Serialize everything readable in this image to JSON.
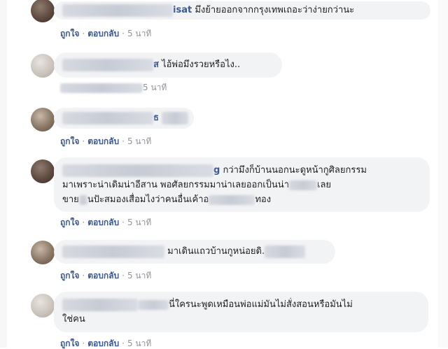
{
  "actions": {
    "like": "ถูกใจ",
    "reply": "ตอบกลับ",
    "dot": "·",
    "time": "5 นาที"
  },
  "comments": [
    {
      "name_visible": "isat",
      "text": "มึงย้ายออกจากกรุงเทพเถอะว่าง่ายกว่านะ"
    },
    {
      "name_visible": "ส",
      "text": "ไอ้พ่อมึงรวยหรือไง.."
    },
    {
      "name_visible": "ธ",
      "text": ""
    },
    {
      "name_visible": "g",
      "text_line1": "กว่ามึงก็บ้านนอกนะดูหน้ากูศิลยกรรม",
      "text_line2": "มาเพราะน่าเดิมน่าอีสาน พอศัลยกรรมมาน่าเลยออกเป็นน่า",
      "text_line2_end": "เลย",
      "text_line3": "ขาย",
      "text_line3_mid": "นปัะสมองเสื่อมไงว่าคนอื่นเค้าอ",
      "text_line3_end": "ทอง"
    },
    {
      "name_visible": "",
      "text": "มาเดินแถวบ้านกูหน่อยดิ."
    },
    {
      "name_visible": "",
      "text_line1": "นี่ใครนะพูดเหมือนพ่อแม่มันไม่สั่งสอนหรือมันไม่",
      "text_line2": "ใช่คน"
    }
  ]
}
